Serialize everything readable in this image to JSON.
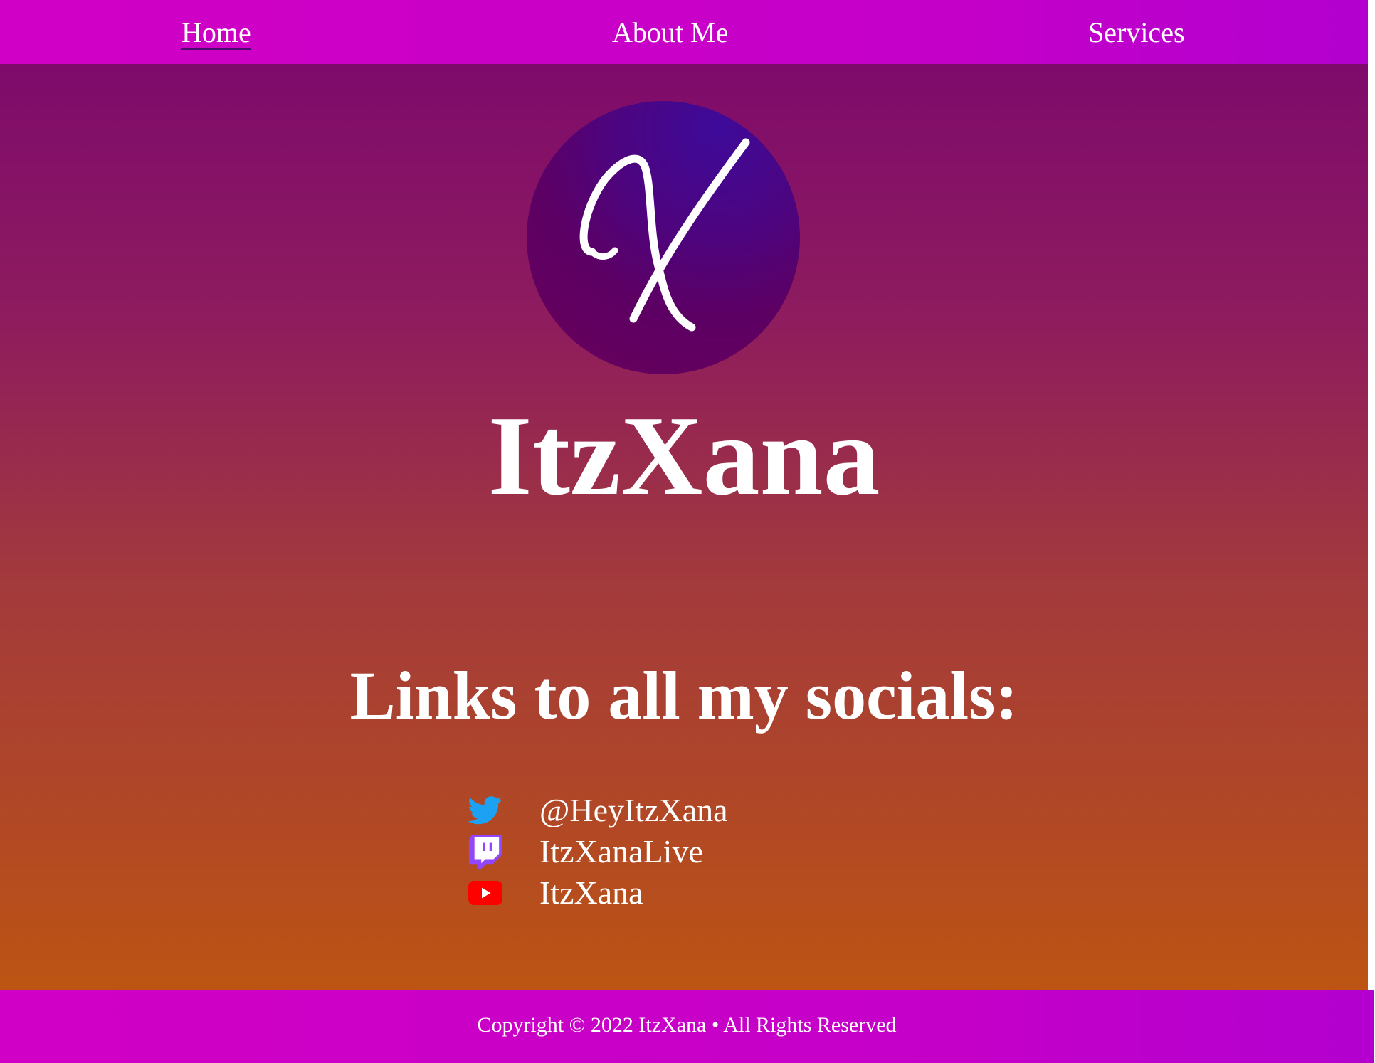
{
  "nav": {
    "items": [
      {
        "label": "Home",
        "active": true
      },
      {
        "label": "About Me",
        "active": false
      },
      {
        "label": "Services",
        "active": false
      }
    ]
  },
  "hero": {
    "avatar_icon": "script-x-logo",
    "title": "ItzXana"
  },
  "socials": {
    "heading": "Links to all my socials:",
    "items": [
      {
        "icon": "twitter-icon",
        "label": "@HeyItzXana",
        "color": "#1da1f2"
      },
      {
        "icon": "twitch-icon",
        "label": "ItzXanaLive",
        "color": "#9146ff"
      },
      {
        "icon": "youtube-icon",
        "label": "ItzXana",
        "color": "#ff0000"
      }
    ]
  },
  "footer": {
    "text": "Copyright © 2022 ItzXana • All Rights Reserved"
  },
  "colors": {
    "nav_bg": "#c900c8",
    "page_top": "#7a066f",
    "page_bottom": "#c25a0c"
  }
}
